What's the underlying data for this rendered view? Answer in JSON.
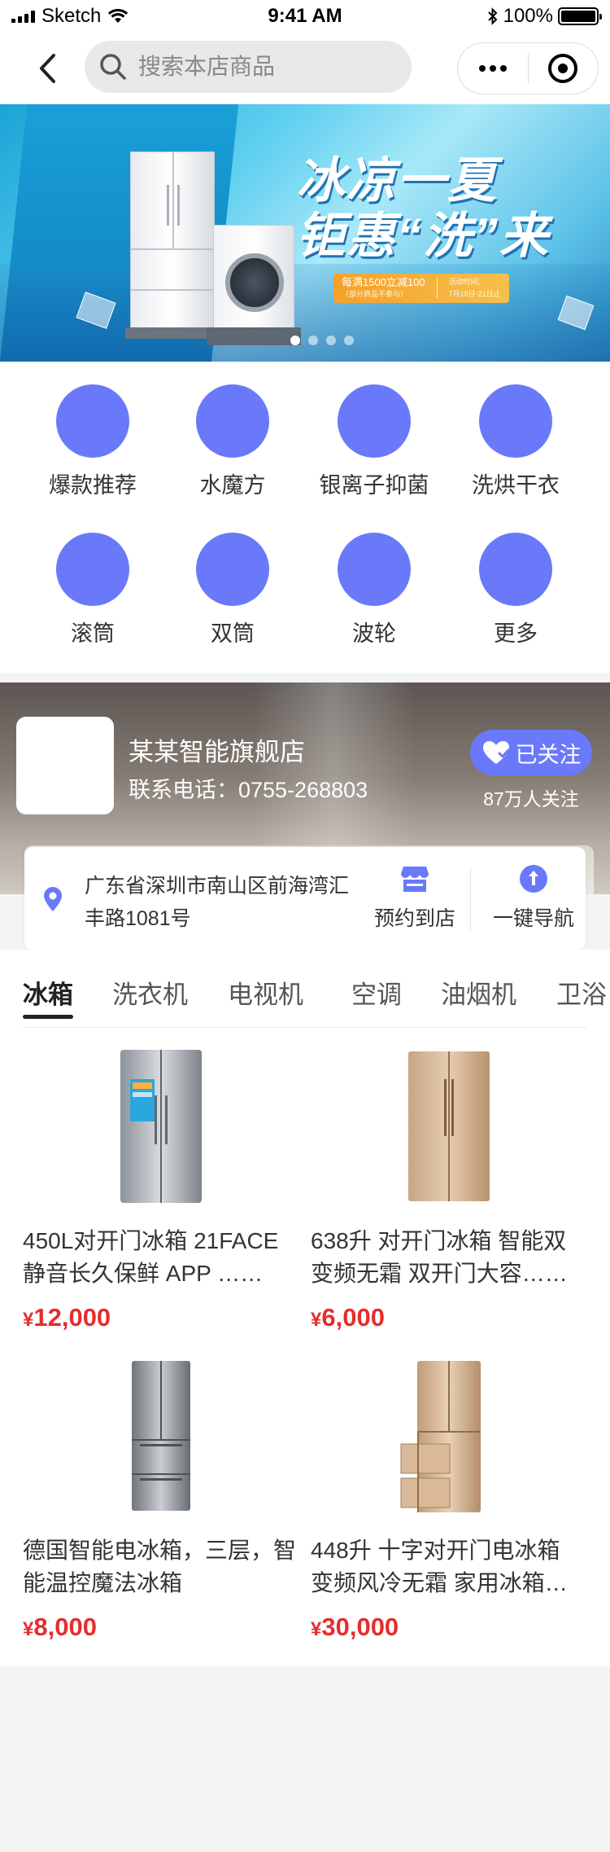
{
  "status_bar": {
    "carrier": "Sketch",
    "time": "9:41 AM",
    "battery": "100%",
    "battery_level": 1.0
  },
  "nav": {
    "search_placeholder": "搜索本店商品",
    "icons": [
      "back-arrow-icon",
      "search-icon",
      "more-icon",
      "target-icon"
    ]
  },
  "banner": {
    "title_line1": "冰凉一夏",
    "title_line2": "钜惠“洗”来",
    "promo_main": "每满1500立减100",
    "promo_sub": "（部分商品不参与）",
    "promo_time_label": "活动时间：",
    "promo_time": "7月18日-21日止",
    "slide_count": 4,
    "active_slide": 1
  },
  "categories": [
    {
      "label": "爆款推荐"
    },
    {
      "label": "水魔方"
    },
    {
      "label": "银离子抑菌"
    },
    {
      "label": "洗烘干衣"
    },
    {
      "label": "滚筒"
    },
    {
      "label": "双筒"
    },
    {
      "label": "波轮"
    },
    {
      "label": "更多"
    }
  ],
  "shop": {
    "name": "某某智能旗舰店",
    "phone": "联系电话：0755-268803",
    "follow_label": "已关注",
    "follow_count": "87万人关注"
  },
  "address": {
    "text": "广东省深圳市南山区前海湾汇丰路1081号",
    "store_label": "预约到店",
    "nav_label": "一键导航"
  },
  "tabs": [
    {
      "label": "冰箱",
      "active": true
    },
    {
      "label": "洗衣机",
      "active": false
    },
    {
      "label": "电视机",
      "active": false
    },
    {
      "label": "空调",
      "active": false
    },
    {
      "label": "油烟机",
      "active": false
    },
    {
      "label": "卫浴",
      "active": false
    }
  ],
  "products": [
    {
      "title": "450L对开门冰箱 21FACE 静音长久保鲜 APP ……",
      "currency": "¥",
      "price": "12,000",
      "image": "fridge-screen-image"
    },
    {
      "title": "638升 对开门冰箱 智能双变频无霜 双开门大容……",
      "currency": "¥",
      "price": "6,000",
      "image": "fridge-champagne-image"
    },
    {
      "title": "德国智能电冰箱，三层，智能温控魔法冰箱",
      "currency": "¥",
      "price": "8,000",
      "image": "fridge-steel-image"
    },
    {
      "title": "448升 十字对开门电冰箱 变频风冷无霜 家用冰箱…",
      "currency": "¥",
      "price": "30,000",
      "image": "fridge-drawers-image"
    }
  ],
  "colors": {
    "accent": "#6a79f9",
    "price": "#e52d2d",
    "background": "#f4f4f4"
  }
}
